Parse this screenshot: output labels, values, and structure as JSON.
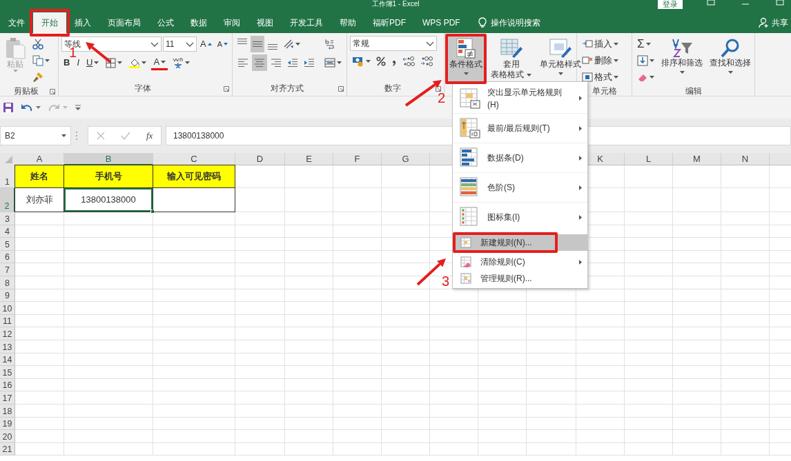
{
  "window": {
    "title": "工作簿1 - Excel",
    "login_label": "登录"
  },
  "tabs": [
    {
      "label": "文件",
      "selected": false
    },
    {
      "label": "开始",
      "selected": true,
      "step": "1"
    },
    {
      "label": "插入",
      "selected": false
    },
    {
      "label": "页面布局",
      "selected": false
    },
    {
      "label": "公式",
      "selected": false
    },
    {
      "label": "数据",
      "selected": false
    },
    {
      "label": "审阅",
      "selected": false
    },
    {
      "label": "视图",
      "selected": false
    },
    {
      "label": "开发工具",
      "selected": false
    },
    {
      "label": "帮助",
      "selected": false
    },
    {
      "label": "福昕PDF",
      "selected": false
    },
    {
      "label": "WPS PDF",
      "selected": false
    }
  ],
  "tell_me": "操作说明搜索",
  "share": "共享",
  "ribbon": {
    "groups": [
      {
        "label": "剪贴板",
        "paste": {
          "label": "粘贴",
          "disabled": true
        }
      },
      {
        "label": "字体",
        "font_name": "等线",
        "font_size": "11",
        "grow": "A",
        "shrink": "A",
        "bold": "B",
        "italic": "I",
        "underline": "U",
        "font_color": "A"
      },
      {
        "label": "对齐方式",
        "vertical_align": [
          {
            "selected": false
          },
          {
            "selected": true
          },
          {
            "selected": false
          }
        ],
        "horizontal_align": [
          {
            "selected": false
          },
          {
            "selected": true
          },
          {
            "selected": false
          }
        ]
      },
      {
        "label": "数字",
        "number_format": "常规"
      },
      {
        "buttons": [
          {
            "lines": [
              "条件格式"
            ],
            "selected": true,
            "step": "2"
          },
          {
            "lines": [
              "套用",
              "表格格式"
            ],
            "selected": false
          },
          {
            "lines": [
              "单元格样式"
            ],
            "selected": false
          }
        ]
      },
      {
        "label": "单元格",
        "buttons": [
          "插入",
          "删除",
          "格式"
        ]
      },
      {
        "label": "编辑",
        "sum": "Σ",
        "buttons": [
          "排序和筛选",
          "查找和选择"
        ]
      }
    ]
  },
  "formula_bar": {
    "name_box": "B2",
    "fx": "fx",
    "formula": "13800138000"
  },
  "columns": [
    {
      "label": "A",
      "selected": false
    },
    {
      "label": "B",
      "selected": true
    },
    {
      "label": "C",
      "selected": false
    },
    {
      "label": "D",
      "selected": false
    },
    {
      "label": "E",
      "selected": false
    },
    {
      "label": "F",
      "selected": false
    },
    {
      "label": "G",
      "selected": false
    },
    {
      "label": "K",
      "selected": false
    },
    {
      "label": "L",
      "selected": false
    },
    {
      "label": "M",
      "selected": false
    },
    {
      "label": "N",
      "selected": false
    }
  ],
  "rows": [
    {
      "number": "1",
      "selected": false,
      "kind": "header",
      "cells": [
        {
          "text": "姓名",
          "selected": false
        },
        {
          "text": "手机号",
          "selected": false
        },
        {
          "text": "输入可见密码",
          "selected": false
        }
      ]
    },
    {
      "number": "2",
      "selected": true,
      "kind": "data",
      "cells": [
        {
          "text": "刘亦菲",
          "selected": false
        },
        {
          "text": "13800138000",
          "selected": true
        },
        {
          "selected": false
        }
      ]
    },
    {
      "number": "3",
      "selected": false
    },
    {
      "number": "4",
      "selected": false
    },
    {
      "number": "5",
      "selected": false
    },
    {
      "number": "6",
      "selected": false
    },
    {
      "number": "7",
      "selected": false
    },
    {
      "number": "8",
      "selected": false
    },
    {
      "number": "9",
      "selected": false
    },
    {
      "number": "10",
      "selected": false
    },
    {
      "number": "11",
      "selected": false
    },
    {
      "number": "12",
      "selected": false
    },
    {
      "number": "13",
      "selected": false
    },
    {
      "number": "14",
      "selected": false
    },
    {
      "number": "15",
      "selected": false
    },
    {
      "number": "16",
      "selected": false
    },
    {
      "number": "17",
      "selected": false
    },
    {
      "number": "18",
      "selected": false
    },
    {
      "number": "19",
      "selected": false
    },
    {
      "number": "20",
      "selected": false
    },
    {
      "number": "21",
      "selected": false
    }
  ],
  "context_menu": {
    "items": [
      {
        "kind": "large",
        "label": "突出显示单元格规则(H)",
        "submenu": true,
        "selected": false
      },
      {
        "kind": "large",
        "label": "最前/最后规则(T)",
        "submenu": true,
        "selected": false
      },
      {
        "kind": "large",
        "label": "数据条(D)",
        "submenu": true,
        "selected": false
      },
      {
        "kind": "large",
        "label": "色阶(S)",
        "submenu": true,
        "selected": false
      },
      {
        "kind": "large",
        "label": "图标集(I)",
        "submenu": true,
        "selected": false
      },
      {
        "kind": "small",
        "label": "新建规则(N)...",
        "submenu": false,
        "selected": true,
        "step": "3"
      },
      {
        "kind": "small",
        "label": "清除规则(C)",
        "submenu": true,
        "selected": false
      },
      {
        "kind": "small",
        "label": "管理规则(R)...",
        "submenu": false,
        "selected": false
      }
    ]
  }
}
